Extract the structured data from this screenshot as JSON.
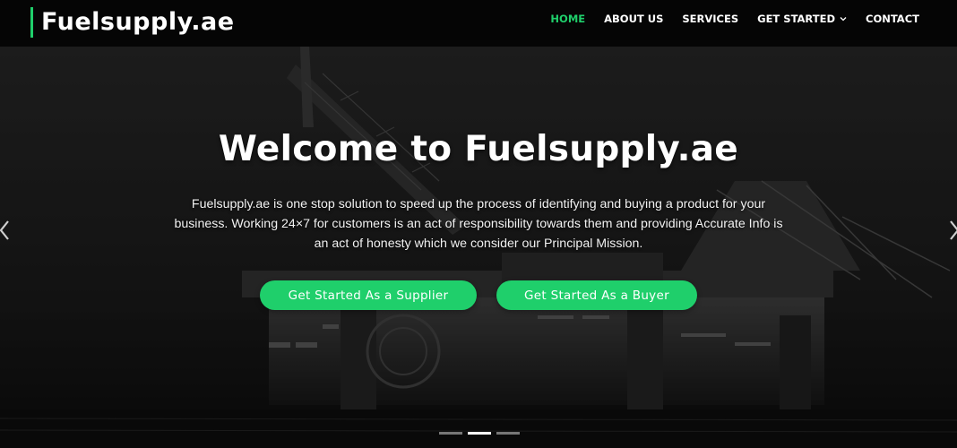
{
  "brand": {
    "logo_text": "Fuelsupply.ae",
    "accent": "#1fcf6b"
  },
  "nav": {
    "items": [
      {
        "label": "HOME",
        "active": true
      },
      {
        "label": "ABOUT US",
        "active": false
      },
      {
        "label": "SERVICES",
        "active": false
      },
      {
        "label": "GET STARTED",
        "active": false,
        "has_dropdown": true,
        "icon": "chevron-down-icon"
      },
      {
        "label": "CONTACT",
        "active": false
      }
    ]
  },
  "hero": {
    "title": "Welcome to Fuelsupply.ae",
    "description": "Fuelsupply.ae is one stop solution to speed up the process of identifying and buying a product for your business. Working 24×7 for customers is an act of responsibility towards them and providing Accurate Info is an act of honesty which we consider our Principal Mission.",
    "buttons": {
      "supplier": "Get Started As a Supplier",
      "buyer": "Get Started As a Buyer"
    },
    "arrows": {
      "prev_icon": "chevron-left-icon",
      "next_icon": "chevron-right-icon"
    },
    "slides": {
      "count": 3,
      "active_index": 1
    }
  }
}
